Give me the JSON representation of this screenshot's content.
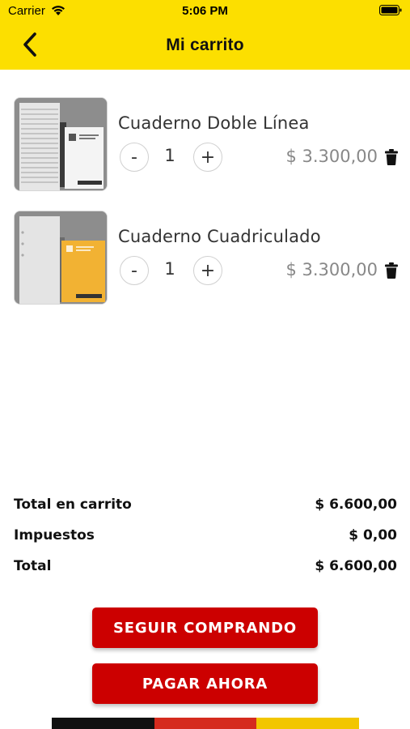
{
  "status_bar": {
    "carrier": "Carrier",
    "time": "5:06 PM"
  },
  "header": {
    "title": "Mi carrito",
    "back_icon": "chevron-left-icon",
    "background": "#fcdf00"
  },
  "cart": {
    "items": [
      {
        "name": "Cuaderno Doble Línea",
        "quantity": "1",
        "price": "$ 3.300,00",
        "minus": "-",
        "plus": "+",
        "delete_icon": "trash-icon"
      },
      {
        "name": "Cuaderno Cuadriculado",
        "quantity": "1",
        "price": "$ 3.300,00",
        "minus": "-",
        "plus": "+",
        "delete_icon": "trash-icon"
      }
    ]
  },
  "summary": {
    "cart_total": {
      "label": "Total en carrito",
      "value": "$ 6.600,00"
    },
    "taxes": {
      "label": "Impuestos",
      "value": "$ 0,00"
    },
    "total": {
      "label": "Total",
      "value": "$ 6.600,00"
    }
  },
  "actions": {
    "continue_label": "SEGUIR COMPRANDO",
    "pay_label": "PAGAR AHORA",
    "button_color": "#cc0000"
  },
  "flag_colors": [
    "#111111",
    "#d52b1e",
    "#f2c600"
  ]
}
